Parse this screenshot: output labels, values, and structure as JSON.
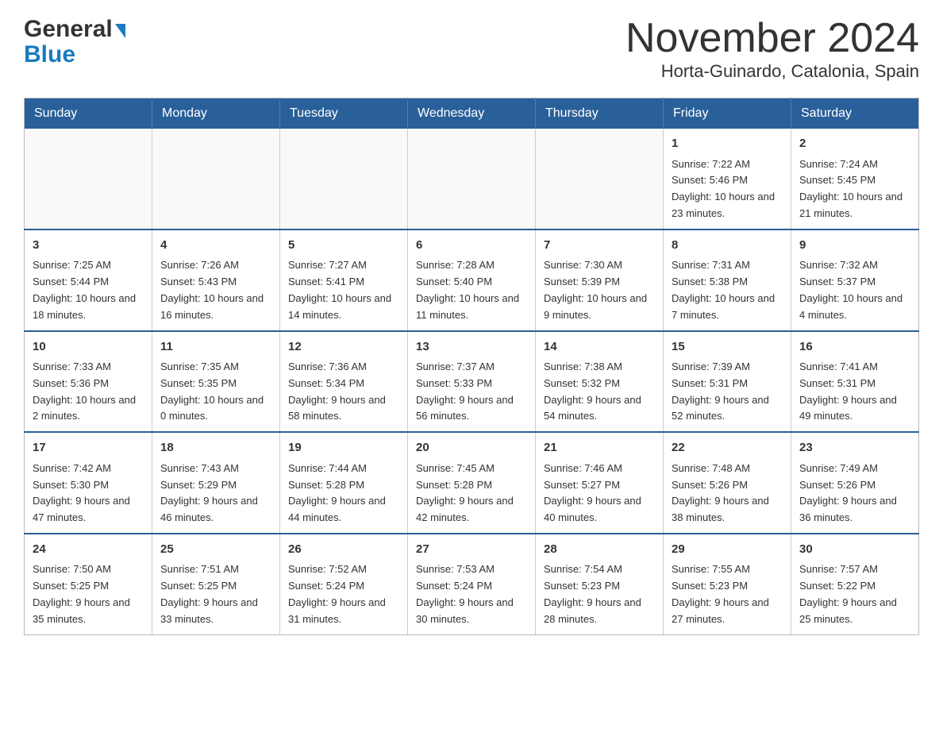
{
  "header": {
    "logo_general": "General",
    "logo_blue": "Blue",
    "title": "November 2024",
    "location": "Horta-Guinardo, Catalonia, Spain"
  },
  "weekdays": [
    "Sunday",
    "Monday",
    "Tuesday",
    "Wednesday",
    "Thursday",
    "Friday",
    "Saturday"
  ],
  "weeks": [
    [
      {
        "day": "",
        "info": ""
      },
      {
        "day": "",
        "info": ""
      },
      {
        "day": "",
        "info": ""
      },
      {
        "day": "",
        "info": ""
      },
      {
        "day": "",
        "info": ""
      },
      {
        "day": "1",
        "info": "Sunrise: 7:22 AM\nSunset: 5:46 PM\nDaylight: 10 hours\nand 23 minutes."
      },
      {
        "day": "2",
        "info": "Sunrise: 7:24 AM\nSunset: 5:45 PM\nDaylight: 10 hours\nand 21 minutes."
      }
    ],
    [
      {
        "day": "3",
        "info": "Sunrise: 7:25 AM\nSunset: 5:44 PM\nDaylight: 10 hours\nand 18 minutes."
      },
      {
        "day": "4",
        "info": "Sunrise: 7:26 AM\nSunset: 5:43 PM\nDaylight: 10 hours\nand 16 minutes."
      },
      {
        "day": "5",
        "info": "Sunrise: 7:27 AM\nSunset: 5:41 PM\nDaylight: 10 hours\nand 14 minutes."
      },
      {
        "day": "6",
        "info": "Sunrise: 7:28 AM\nSunset: 5:40 PM\nDaylight: 10 hours\nand 11 minutes."
      },
      {
        "day": "7",
        "info": "Sunrise: 7:30 AM\nSunset: 5:39 PM\nDaylight: 10 hours\nand 9 minutes."
      },
      {
        "day": "8",
        "info": "Sunrise: 7:31 AM\nSunset: 5:38 PM\nDaylight: 10 hours\nand 7 minutes."
      },
      {
        "day": "9",
        "info": "Sunrise: 7:32 AM\nSunset: 5:37 PM\nDaylight: 10 hours\nand 4 minutes."
      }
    ],
    [
      {
        "day": "10",
        "info": "Sunrise: 7:33 AM\nSunset: 5:36 PM\nDaylight: 10 hours\nand 2 minutes."
      },
      {
        "day": "11",
        "info": "Sunrise: 7:35 AM\nSunset: 5:35 PM\nDaylight: 10 hours\nand 0 minutes."
      },
      {
        "day": "12",
        "info": "Sunrise: 7:36 AM\nSunset: 5:34 PM\nDaylight: 9 hours\nand 58 minutes."
      },
      {
        "day": "13",
        "info": "Sunrise: 7:37 AM\nSunset: 5:33 PM\nDaylight: 9 hours\nand 56 minutes."
      },
      {
        "day": "14",
        "info": "Sunrise: 7:38 AM\nSunset: 5:32 PM\nDaylight: 9 hours\nand 54 minutes."
      },
      {
        "day": "15",
        "info": "Sunrise: 7:39 AM\nSunset: 5:31 PM\nDaylight: 9 hours\nand 52 minutes."
      },
      {
        "day": "16",
        "info": "Sunrise: 7:41 AM\nSunset: 5:31 PM\nDaylight: 9 hours\nand 49 minutes."
      }
    ],
    [
      {
        "day": "17",
        "info": "Sunrise: 7:42 AM\nSunset: 5:30 PM\nDaylight: 9 hours\nand 47 minutes."
      },
      {
        "day": "18",
        "info": "Sunrise: 7:43 AM\nSunset: 5:29 PM\nDaylight: 9 hours\nand 46 minutes."
      },
      {
        "day": "19",
        "info": "Sunrise: 7:44 AM\nSunset: 5:28 PM\nDaylight: 9 hours\nand 44 minutes."
      },
      {
        "day": "20",
        "info": "Sunrise: 7:45 AM\nSunset: 5:28 PM\nDaylight: 9 hours\nand 42 minutes."
      },
      {
        "day": "21",
        "info": "Sunrise: 7:46 AM\nSunset: 5:27 PM\nDaylight: 9 hours\nand 40 minutes."
      },
      {
        "day": "22",
        "info": "Sunrise: 7:48 AM\nSunset: 5:26 PM\nDaylight: 9 hours\nand 38 minutes."
      },
      {
        "day": "23",
        "info": "Sunrise: 7:49 AM\nSunset: 5:26 PM\nDaylight: 9 hours\nand 36 minutes."
      }
    ],
    [
      {
        "day": "24",
        "info": "Sunrise: 7:50 AM\nSunset: 5:25 PM\nDaylight: 9 hours\nand 35 minutes."
      },
      {
        "day": "25",
        "info": "Sunrise: 7:51 AM\nSunset: 5:25 PM\nDaylight: 9 hours\nand 33 minutes."
      },
      {
        "day": "26",
        "info": "Sunrise: 7:52 AM\nSunset: 5:24 PM\nDaylight: 9 hours\nand 31 minutes."
      },
      {
        "day": "27",
        "info": "Sunrise: 7:53 AM\nSunset: 5:24 PM\nDaylight: 9 hours\nand 30 minutes."
      },
      {
        "day": "28",
        "info": "Sunrise: 7:54 AM\nSunset: 5:23 PM\nDaylight: 9 hours\nand 28 minutes."
      },
      {
        "day": "29",
        "info": "Sunrise: 7:55 AM\nSunset: 5:23 PM\nDaylight: 9 hours\nand 27 minutes."
      },
      {
        "day": "30",
        "info": "Sunrise: 7:57 AM\nSunset: 5:22 PM\nDaylight: 9 hours\nand 25 minutes."
      }
    ]
  ]
}
